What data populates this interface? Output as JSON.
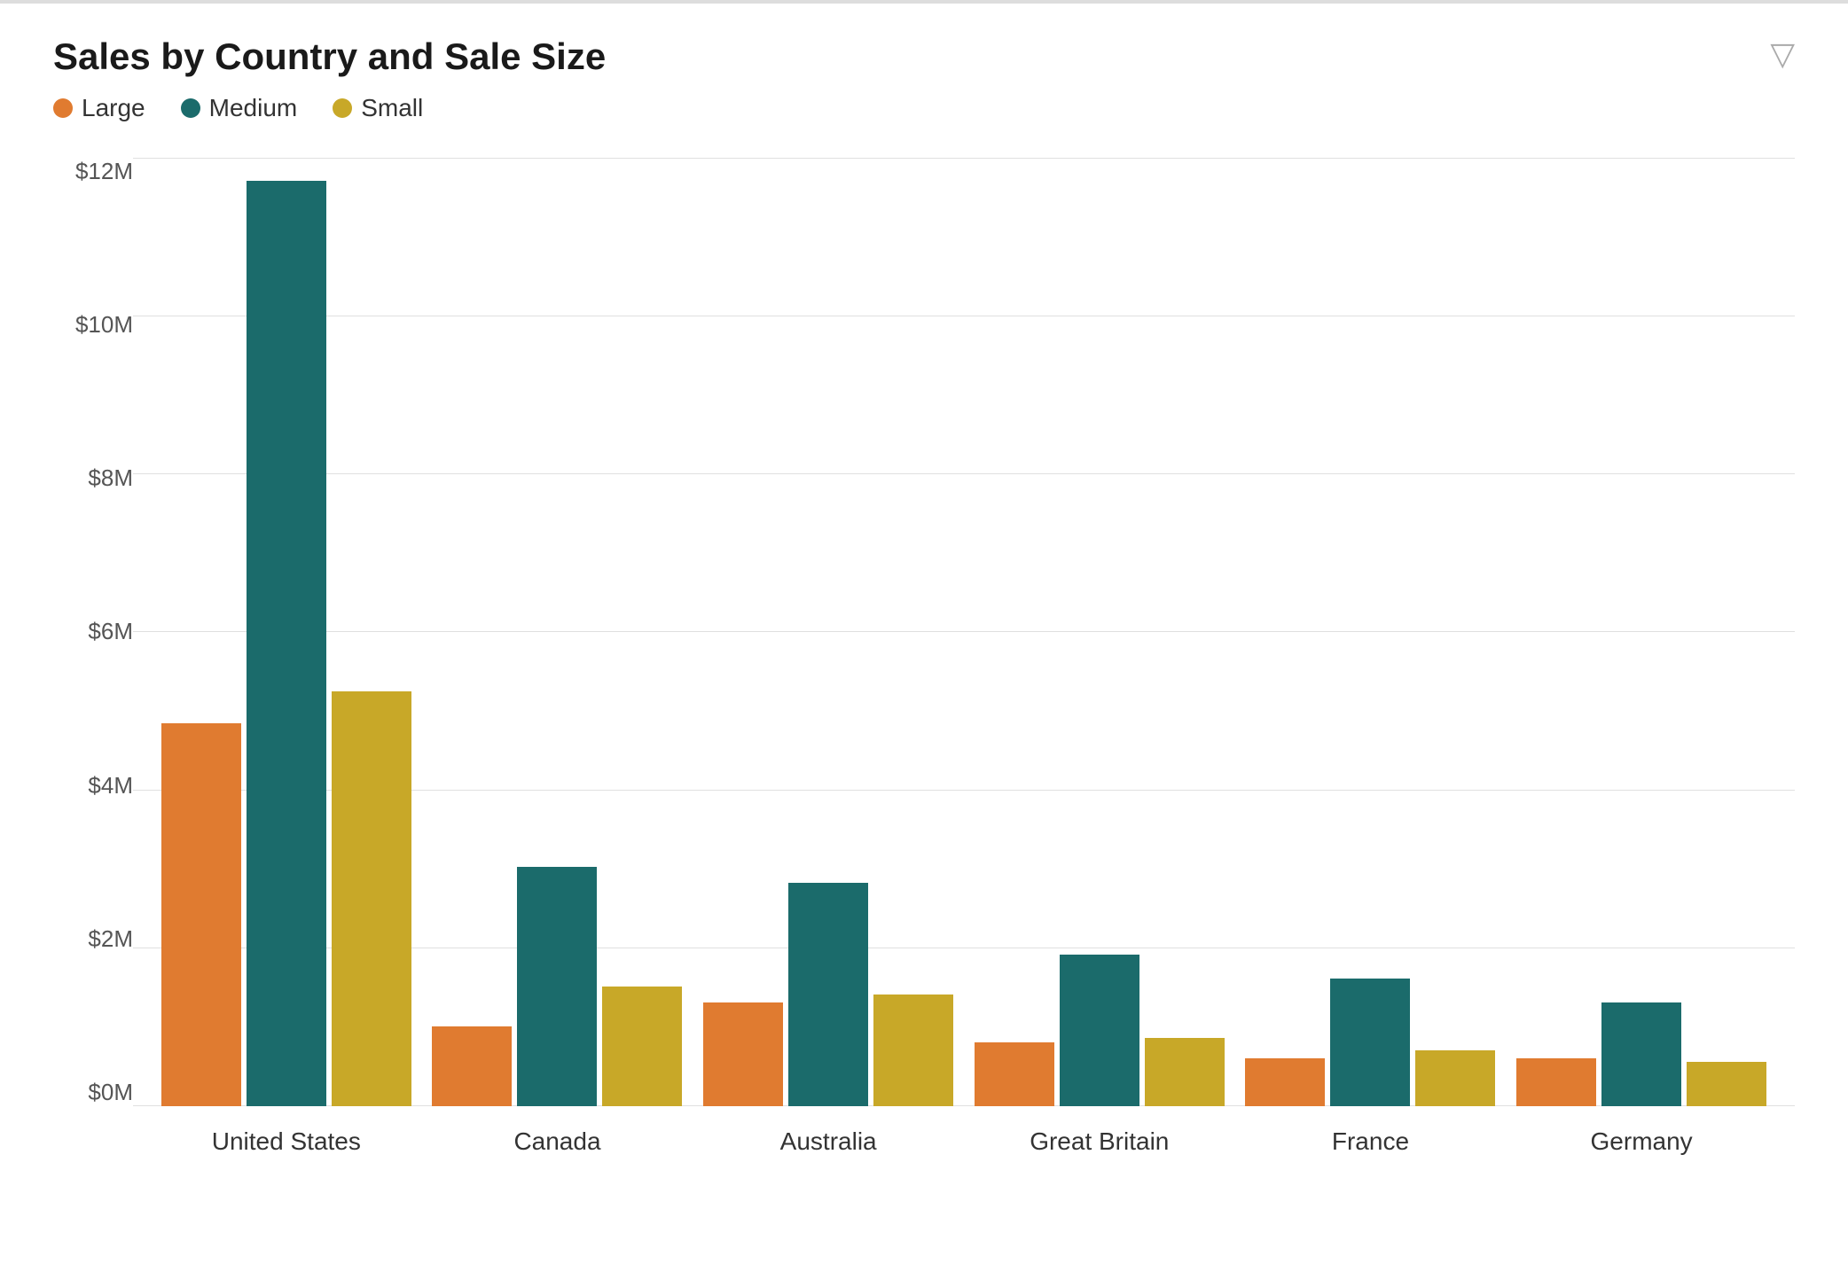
{
  "chart": {
    "title": "Sales by Country and Sale Size",
    "filter_icon": "▽",
    "legend": [
      {
        "key": "large",
        "label": "Large",
        "color": "#E07B30"
      },
      {
        "key": "medium",
        "label": "Medium",
        "color": "#1B6B6B"
      },
      {
        "key": "small",
        "label": "Small",
        "color": "#C8A828"
      }
    ],
    "y_axis": {
      "labels": [
        "$12M",
        "$10M",
        "$8M",
        "$6M",
        "$4M",
        "$2M",
        "$0M"
      ],
      "max": 12
    },
    "countries": [
      {
        "name": "United States",
        "large": 4.8,
        "medium": 11.6,
        "small": 5.2
      },
      {
        "name": "Canada",
        "large": 1.0,
        "medium": 3.0,
        "small": 1.5
      },
      {
        "name": "Australia",
        "large": 1.3,
        "medium": 2.8,
        "small": 1.4
      },
      {
        "name": "Great Britain",
        "large": 0.8,
        "medium": 1.9,
        "small": 0.85
      },
      {
        "name": "France",
        "large": 0.6,
        "medium": 1.6,
        "small": 0.7
      },
      {
        "name": "Germany",
        "large": 0.6,
        "medium": 1.3,
        "small": 0.55
      }
    ]
  }
}
